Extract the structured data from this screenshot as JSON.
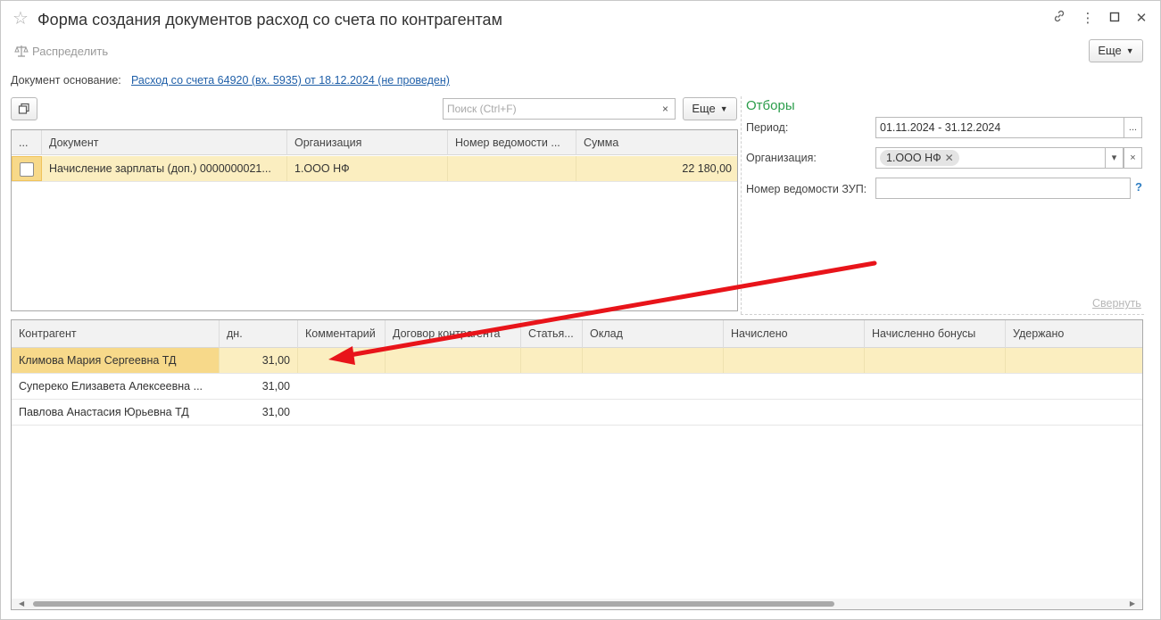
{
  "window": {
    "title": "Форма создания документов расход со счета по контрагентам",
    "star_icon": "☆",
    "link_icon": "🔗",
    "more_icon": "⋮",
    "maximize_icon": "☐",
    "close_icon": "✕"
  },
  "toolbar": {
    "distribute_label": "Распределить",
    "more_label": "Еще"
  },
  "basis": {
    "label": "Документ основание:",
    "link": "Расход со счета 64920 (вх. 5935) от 18.12.2024 (не проведен)"
  },
  "top_table": {
    "search_placeholder": "Поиск (Ctrl+F)",
    "clear_icon": "×",
    "more_label": "Еще",
    "columns": [
      "...",
      "Документ",
      "Организация",
      "Номер ведомости ...",
      "Сумма"
    ],
    "rows": [
      {
        "checked": false,
        "document": "Начисление зарплаты (доп.) 0000000021...",
        "organization": "1.ООО НФ",
        "statement_no": "",
        "sum": "22 180,00"
      }
    ]
  },
  "filters": {
    "title": "Отборы",
    "period_label": "Период:",
    "period_value": "01.11.2024 - 31.12.2024",
    "period_btn": "...",
    "org_label": "Организация:",
    "org_tag": "1.ООО НФ",
    "org_dropdown": "▾",
    "org_clear": "×",
    "zup_label": "Номер ведомости ЗУП:",
    "zup_value": "",
    "help": "?",
    "collapse_label": "Свернуть"
  },
  "bottom_table": {
    "columns": [
      "Контрагент",
      "дн.",
      "Комментарий",
      "Договор контрагента",
      "Статья...",
      "Оклад",
      "Начислено",
      "Начисленно бонусы",
      "Удержано"
    ],
    "rows": [
      {
        "name": "Климова Мария Сергеевна ТД",
        "days": "31,00"
      },
      {
        "name": "Суперeко Елизавета Алексеевна ...",
        "days": "31,00"
      },
      {
        "name": "Павлова Анастасия Юрьевна ТД",
        "days": "31,00"
      }
    ]
  },
  "colors": {
    "selection": "#fbeec0",
    "current_cell": "#f7d98a",
    "filters_title": "#2a9d4a",
    "link": "#1f5fa8",
    "arrow": "#e8141a"
  }
}
